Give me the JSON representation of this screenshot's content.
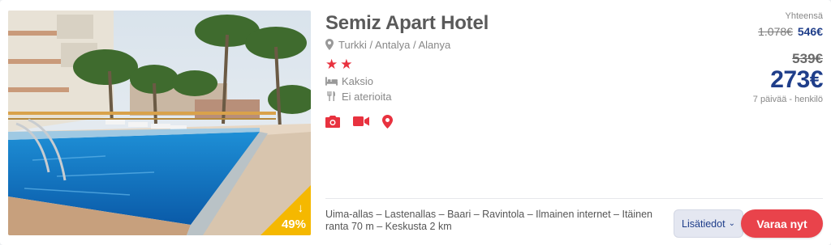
{
  "hotel": {
    "name": "Semiz Apart Hotel",
    "location": "Turkki / Antalya / Alanya",
    "stars": 2,
    "features": [
      {
        "icon": "bed-icon",
        "label": "Kaksio"
      },
      {
        "icon": "cutlery-icon",
        "label": "Ei aterioita"
      }
    ],
    "media_icons": [
      "camera-icon",
      "video-icon",
      "map-pin-icon"
    ],
    "amenities": "Uima-allas – Lastenallas – Baari – Ravintola – Ilmainen internet – Itäinen ranta 70 m – Keskusta 2 km"
  },
  "image": {
    "discount": "49%",
    "discount_icon": "arrow-down-icon"
  },
  "price": {
    "total_label": "Yhteensä",
    "total_old": "1.078€",
    "total_new": "546€",
    "per_person_old": "539€",
    "per_person_new": "273€",
    "note": "7 päivää - henkilö"
  },
  "actions": {
    "more_label": "Lisätiedot",
    "book_label": "Varaa nyt"
  },
  "colors": {
    "accent_red": "#e9434b",
    "price_blue": "#1f3e8a",
    "badge_yellow": "#f5b800",
    "icon_red": "#e8323f"
  }
}
